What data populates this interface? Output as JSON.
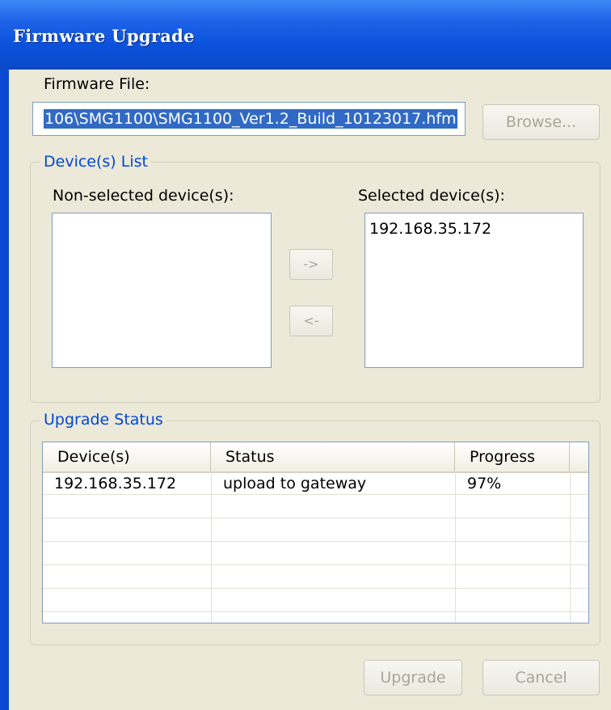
{
  "window": {
    "title": "Firmware Upgrade"
  },
  "firmware": {
    "label": "Firmware File:",
    "path": "106\\SMG1100\\SMG1100_Ver1.2_Build_10123017.hfm",
    "browse_label": "Browse..."
  },
  "devices": {
    "group_label": "Device(s) List",
    "non_selected_label": "Non-selected device(s):",
    "selected_label": "Selected device(s):",
    "non_selected_items": [],
    "selected_items": [
      "192.168.35.172"
    ],
    "move_right_label": "->",
    "move_left_label": "<-"
  },
  "status": {
    "group_label": "Upgrade Status",
    "columns": [
      "Device(s)",
      "Status",
      "Progress"
    ],
    "rows": [
      {
        "device": "192.168.35.172",
        "status": "upload to gateway",
        "progress": "97%"
      }
    ]
  },
  "actions": {
    "upgrade_label": "Upgrade",
    "cancel_label": "Cancel"
  }
}
